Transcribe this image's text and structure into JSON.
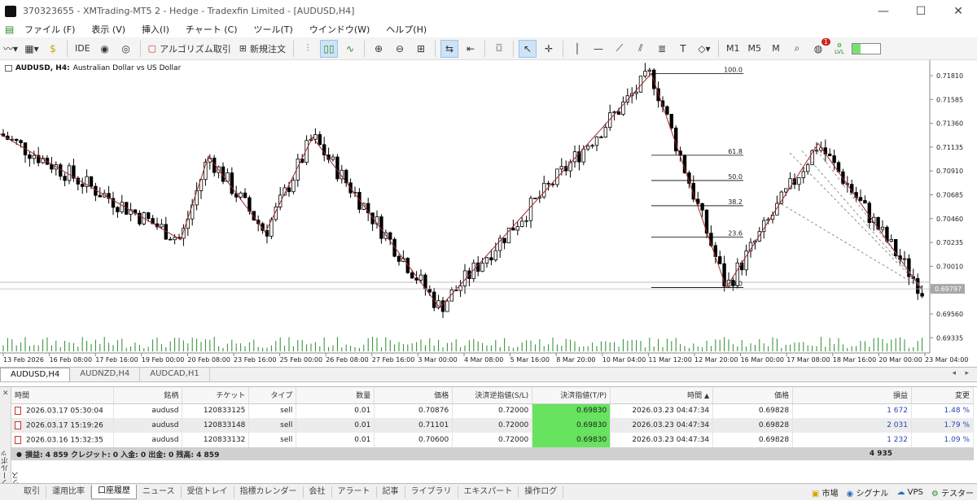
{
  "window": {
    "title": "370323655 - XMTrading-MT5 2 - Hedge - Tradexfin Limited - [AUDUSD,H4]",
    "controls": [
      "—",
      "☐",
      "✕"
    ]
  },
  "menu": [
    "ファイル (F)",
    "表示 (V)",
    "挿入(I)",
    "チャート (C)",
    "ツール(T)",
    "ウインドウ(W)",
    "ヘルプ(H)"
  ],
  "toolbar": {
    "ide": "IDE",
    "algo": "アルゴリズム取引",
    "new_order": "新規注文",
    "tf_m1": "M1",
    "tf_m5": "M5",
    "tf_m": "M",
    "badge": "1",
    "lvl": "LVL"
  },
  "chart": {
    "symbol": "AUDUSD, H4:",
    "description": "Australian Dollar vs US Dollar",
    "current_price": "0.69797",
    "y_ticks": [
      "0.71810",
      "0.71585",
      "0.71360",
      "0.71135",
      "0.70910",
      "0.70685",
      "0.70460",
      "0.70235",
      "0.70010",
      "0.69785",
      "0.69560",
      "0.69335"
    ],
    "x_ticks": [
      "13 Feb 2026",
      "16 Feb 08:00",
      "17 Feb 16:00",
      "19 Feb 00:00",
      "20 Feb 08:00",
      "23 Feb 16:00",
      "25 Feb 00:00",
      "26 Feb 08:00",
      "27 Feb 16:00",
      "3 Mar 00:00",
      "4 Mar 08:00",
      "5 Mar 16:00",
      "8 Mar 20:00",
      "10 Mar 04:00",
      "11 Mar 12:00",
      "12 Mar 20:00",
      "16 Mar 00:00",
      "17 Mar 08:00",
      "18 Mar 16:00",
      "20 Mar 00:00",
      "23 Mar 04:00"
    ],
    "fib_levels": [
      "100.0",
      "61.8",
      "50.0",
      "38.2",
      "23.6",
      "0.0"
    ]
  },
  "chart_tabs": [
    "AUDUSD,H4",
    "AUDNZD,H4",
    "AUDCAD,H1"
  ],
  "positions": {
    "headers": [
      "時間",
      "銘柄",
      "チケット",
      "タイプ",
      "数量",
      "価格",
      "決済逆指値(S/L)",
      "決済指値(T/P)",
      "時間",
      "価格",
      "損益",
      "変更"
    ],
    "sort_indicator": "▲",
    "rows": [
      {
        "time": "2026.03.17 05:30:04",
        "symbol": "audusd",
        "ticket": "120833125",
        "type": "sell",
        "volume": "0.01",
        "price": "0.70876",
        "sl": "0.72000",
        "tp": "0.69830",
        "time2": "2026.03.23 04:47:34",
        "price2": "0.69828",
        "profit": "1 672",
        "change": "1.48 %"
      },
      {
        "time": "2026.03.17 15:19:26",
        "symbol": "audusd",
        "ticket": "120833148",
        "type": "sell",
        "volume": "0.01",
        "price": "0.71101",
        "sl": "0.72000",
        "tp": "0.69830",
        "time2": "2026.03.23 04:47:34",
        "price2": "0.69828",
        "profit": "2 031",
        "change": "1.79 %"
      },
      {
        "time": "2026.03.16 15:32:35",
        "symbol": "audusd",
        "ticket": "120833132",
        "type": "sell",
        "volume": "0.01",
        "price": "0.70600",
        "sl": "0.72000",
        "tp": "0.69830",
        "time2": "2026.03.23 04:47:34",
        "price2": "0.69828",
        "profit": "1 232",
        "change": "1.09 %"
      }
    ],
    "summary": "損益: 4 859  クレジット: 0  入金: 0  出金: 0  残高: 4 859",
    "total": "4 935"
  },
  "side_label": "ツールボックス",
  "bottom_tabs": [
    "取引",
    "運用比率",
    "口座履歴",
    "ニュース",
    "受信トレイ",
    "指標カレンダー",
    "会社",
    "アラート",
    "記事",
    "ライブラリ",
    "エキスパート",
    "操作ログ"
  ],
  "active_bottom_tab": "口座履歴",
  "status": [
    "市場",
    "シグナル",
    "VPS",
    "テスター"
  ],
  "colors": {
    "bull": "#ffffff",
    "bear": "#000000",
    "zigzag": "#a0282c",
    "volume": "#2e8b2e",
    "tp_cell": "#67e35f"
  }
}
